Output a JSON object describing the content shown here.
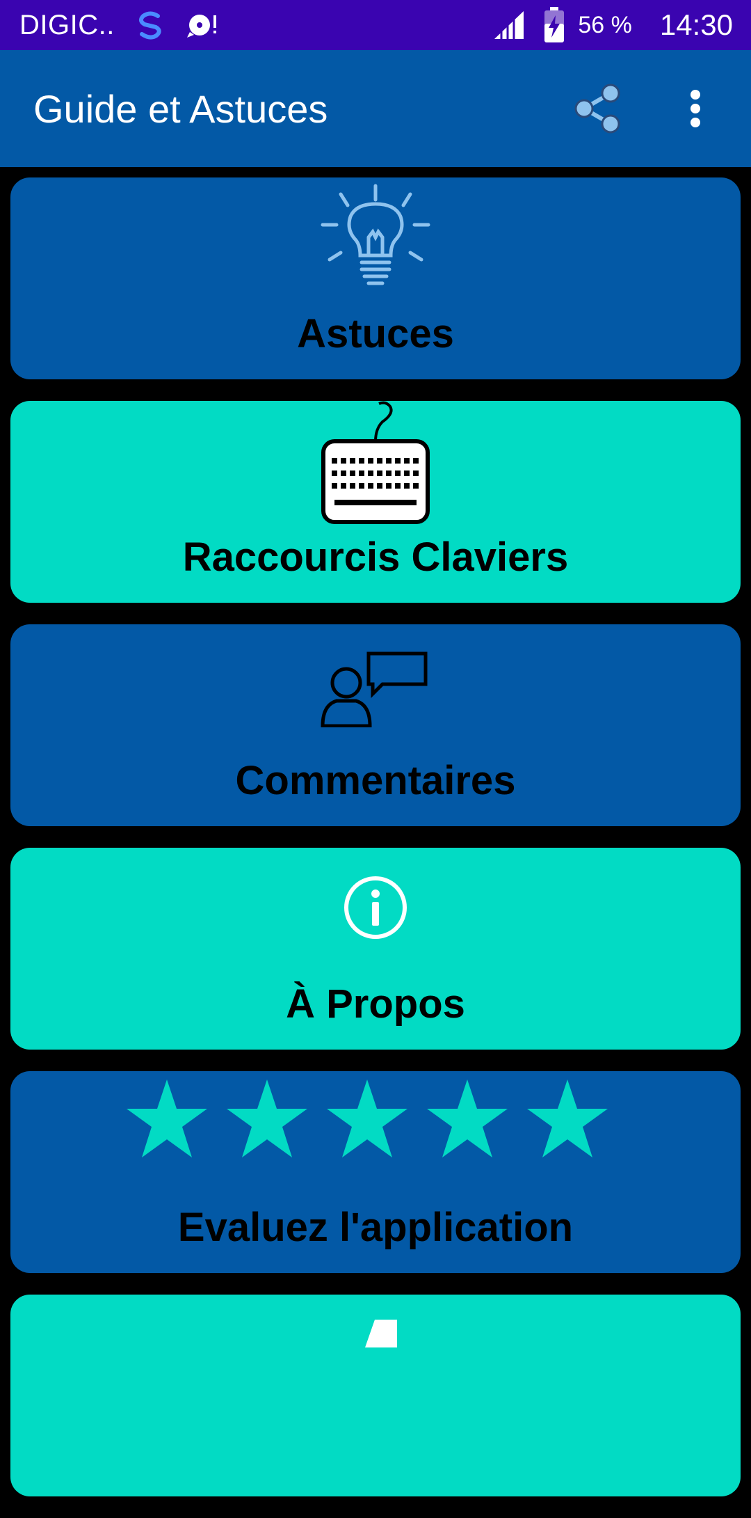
{
  "status_bar": {
    "carrier": "DIGIC..",
    "battery_percent": "56 %",
    "time": "14:30"
  },
  "app_bar": {
    "title": "Guide et Astuces",
    "share_icon": "share-icon",
    "overflow_icon": "more-vert-icon"
  },
  "menu": {
    "items": [
      {
        "label": "Astuces",
        "icon": "lightbulb-icon",
        "color": "#0359a6"
      },
      {
        "label": "Raccourcis Claviers",
        "icon": "keyboard-icon",
        "color": "#02dbc4"
      },
      {
        "label": "Commentaires",
        "icon": "user-comment-icon",
        "color": "#0359a6"
      },
      {
        "label": "À Propos",
        "icon": "info-icon",
        "color": "#02dbc4"
      },
      {
        "label": "Evaluez l'application",
        "icon": "rating-stars-icon",
        "rating": 5,
        "rating_max": 5,
        "color": "#0359a6"
      },
      {
        "label": "",
        "icon": "partial-icon",
        "color": "#02dbc4"
      }
    ]
  },
  "colors": {
    "status_bar": "#3a04b0",
    "app_bar": "#0359a6",
    "background": "#000000",
    "card_blue": "#0359a6",
    "card_teal": "#02dbc4",
    "icon_light_blue": "#8fc3ee"
  }
}
